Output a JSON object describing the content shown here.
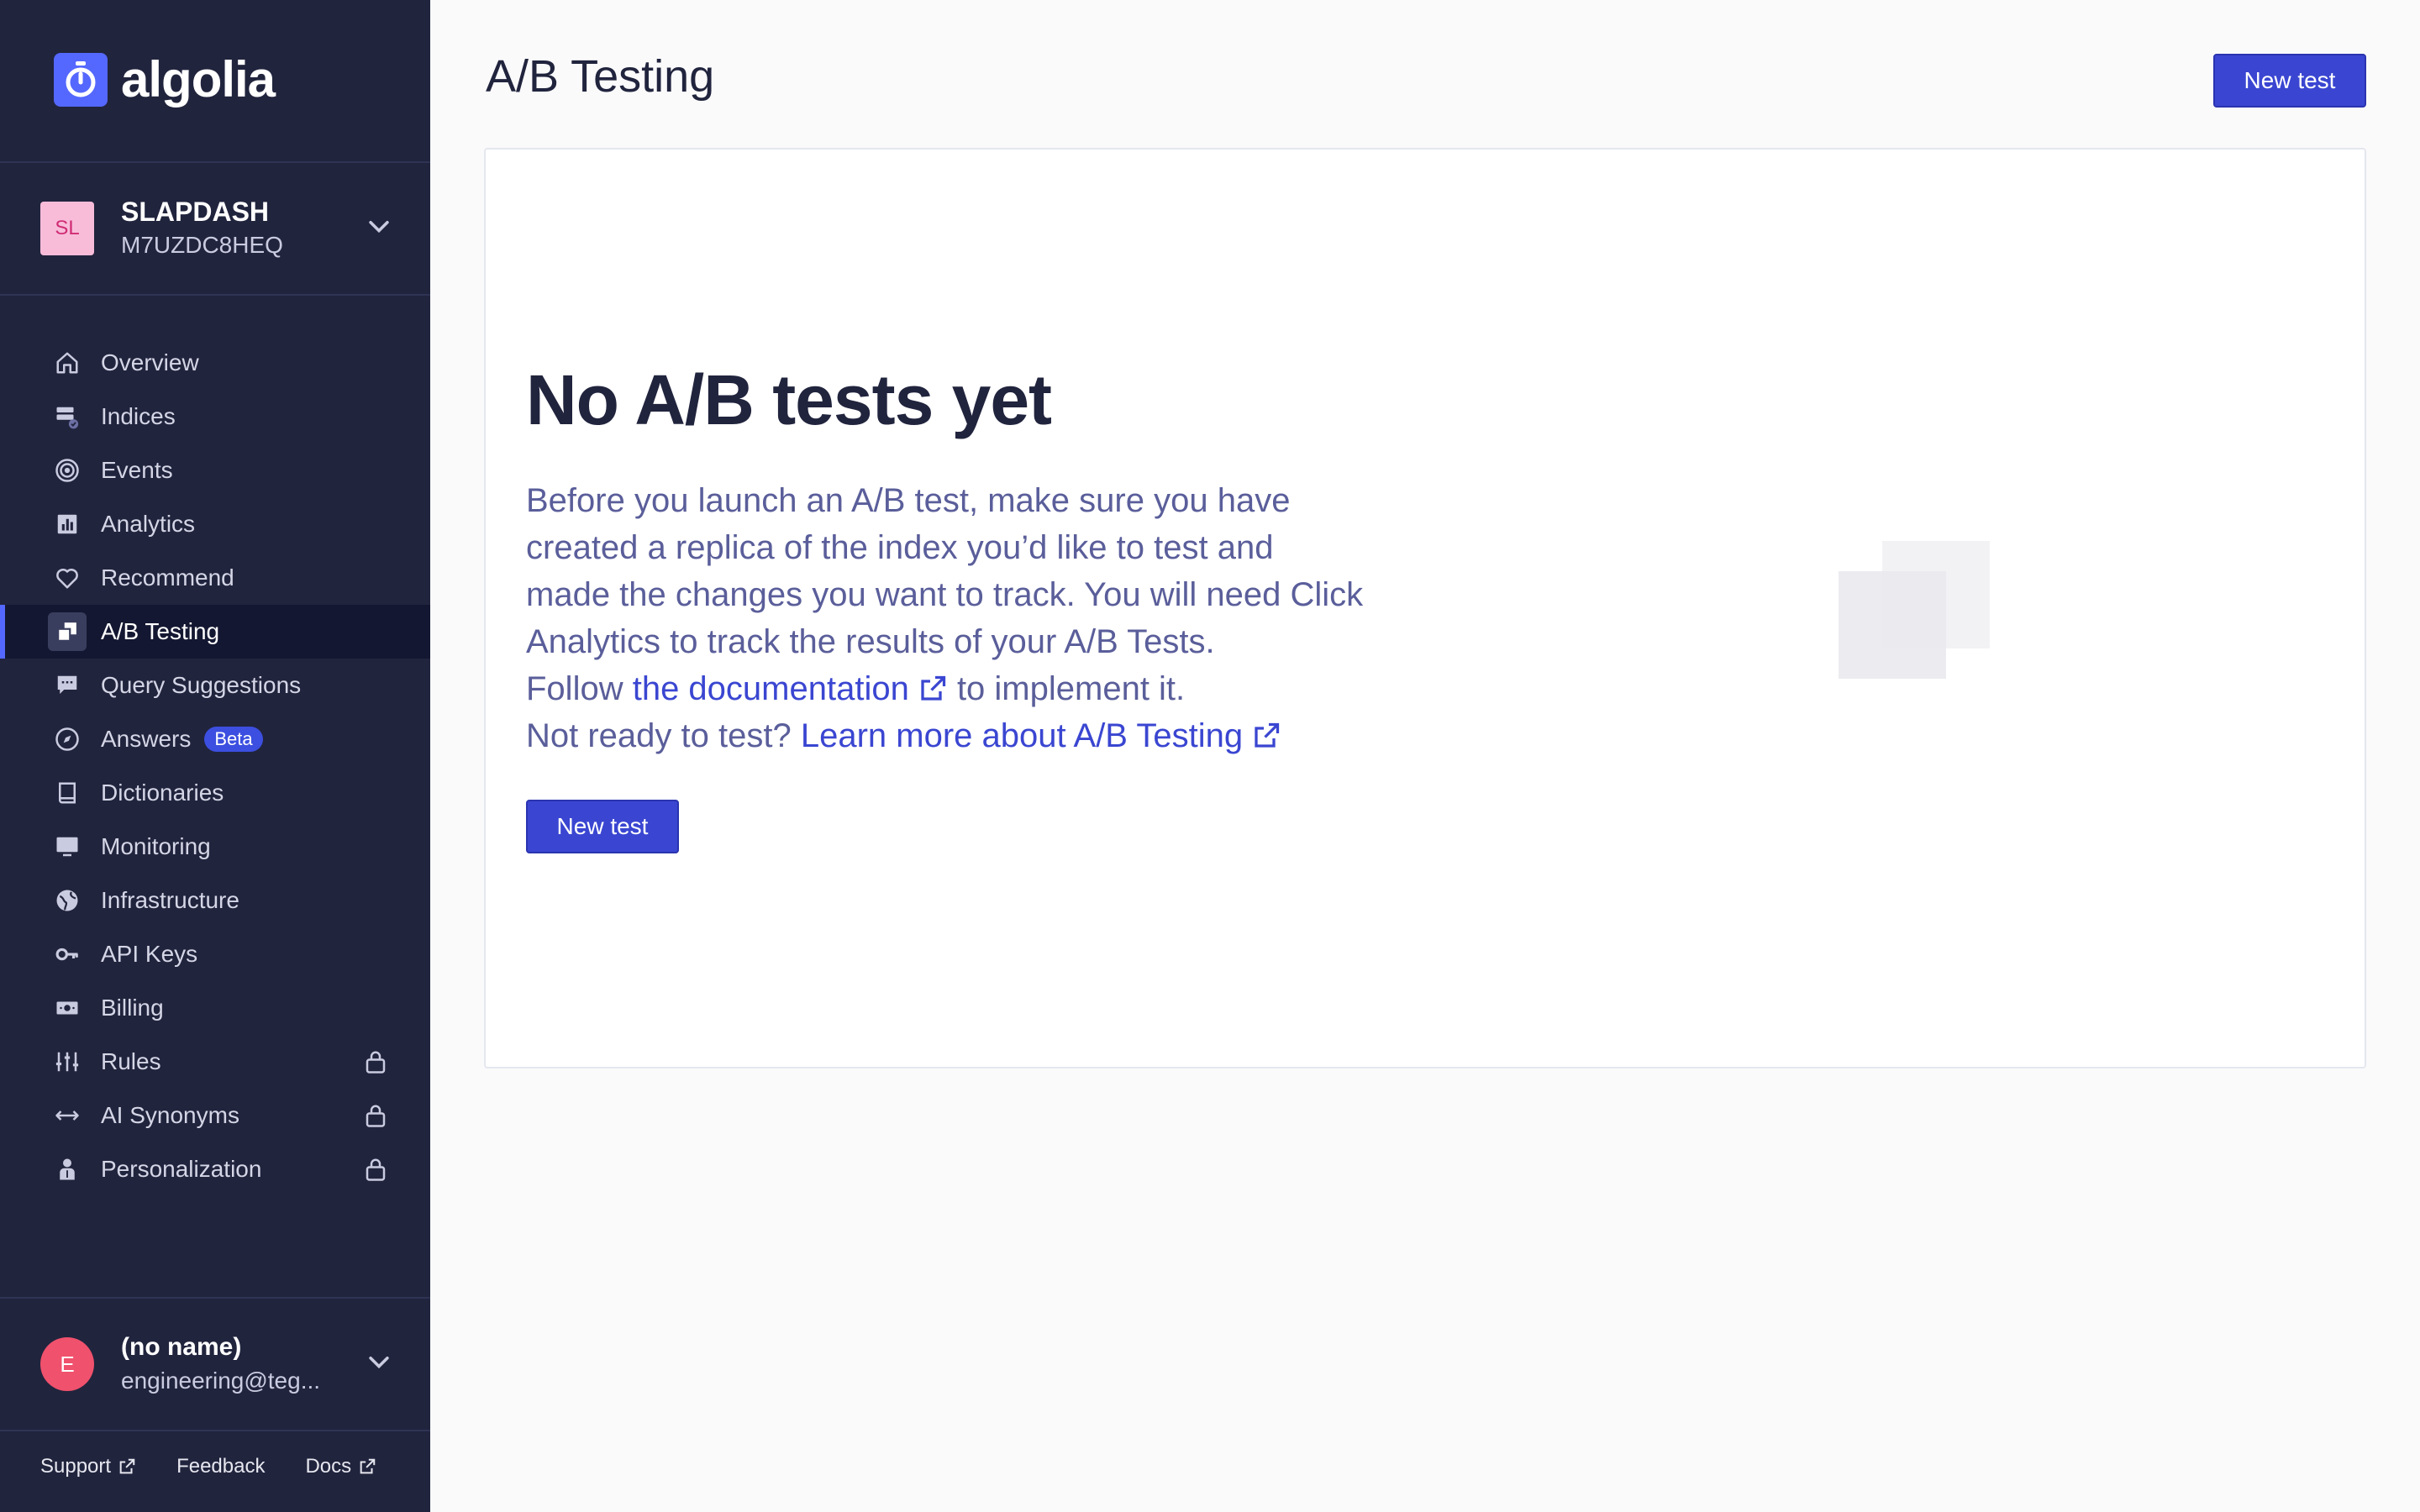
{
  "brand": {
    "name": "algolia",
    "icon": "algolia-stopwatch-icon"
  },
  "app": {
    "initials": "SL",
    "name": "SLAPDASH",
    "id": "M7UZDC8HEQ"
  },
  "nav": {
    "items": [
      {
        "label": "Overview",
        "icon": "home-icon"
      },
      {
        "label": "Indices",
        "icon": "indices-icon"
      },
      {
        "label": "Events",
        "icon": "target-icon"
      },
      {
        "label": "Analytics",
        "icon": "bar-chart-icon"
      },
      {
        "label": "Recommend",
        "icon": "heart-icon"
      },
      {
        "label": "A/B Testing",
        "icon": "ab-testing-icon",
        "active": true
      },
      {
        "label": "Query Suggestions",
        "icon": "chat-icon"
      },
      {
        "label": "Answers",
        "icon": "compass-icon",
        "badge": "Beta"
      },
      {
        "label": "Dictionaries",
        "icon": "book-icon"
      },
      {
        "label": "Monitoring",
        "icon": "monitor-icon"
      },
      {
        "label": "Infrastructure",
        "icon": "globe-icon"
      },
      {
        "label": "API Keys",
        "icon": "key-icon"
      },
      {
        "label": "Billing",
        "icon": "money-icon"
      },
      {
        "label": "Rules",
        "icon": "sliders-icon",
        "locked": true
      },
      {
        "label": "AI Synonyms",
        "icon": "arrows-horizontal-icon",
        "locked": true
      },
      {
        "label": "Personalization",
        "icon": "person-icon",
        "locked": true
      }
    ]
  },
  "user": {
    "initial": "E",
    "name": "(no name)",
    "email": "engineering@teg..."
  },
  "footer": {
    "support": "Support",
    "feedback": "Feedback",
    "docs": "Docs"
  },
  "page": {
    "title": "A/B Testing",
    "new_test_label": "New test"
  },
  "empty_state": {
    "title": "No A/B tests yet",
    "line1": "Before you launch an A/B test, make sure you have created a replica of the index you’d like to test and made the changes you want to track. You will need Click Analytics to track the results of your A/B Tests.",
    "follow_prefix": "Follow ",
    "doc_link": "the documentation",
    "follow_suffix": " to implement it.",
    "ready_prefix": "Not ready to test? ",
    "learn_link": "Learn more about A/B Testing",
    "button_label": "New test"
  },
  "colors": {
    "accent": "#3a46d1",
    "sidebar": "#21243d",
    "brand": "#5468ff"
  }
}
